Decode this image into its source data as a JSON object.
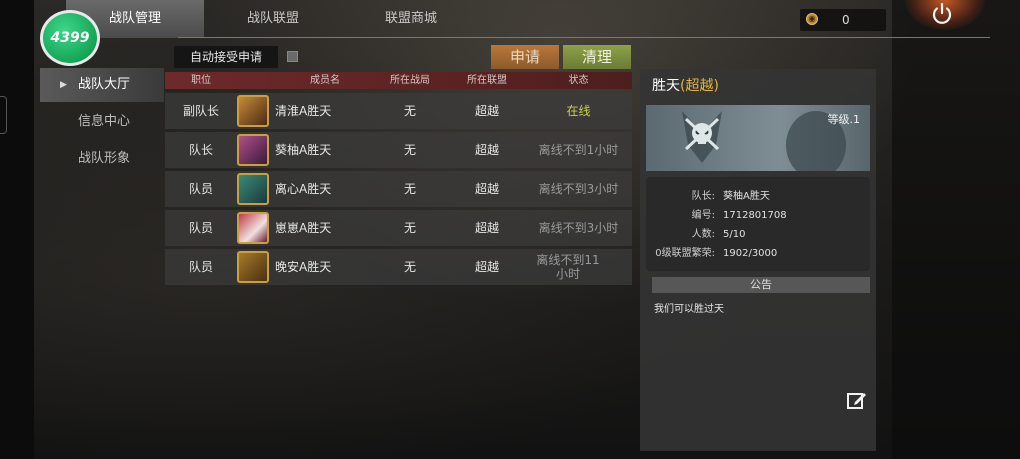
{
  "nav": {
    "tabs": [
      {
        "label": "战队管理",
        "active": true
      },
      {
        "label": "战队联盟",
        "active": false
      },
      {
        "label": "联盟商城",
        "active": false
      }
    ]
  },
  "logo": {
    "text": "4399"
  },
  "currency": {
    "icon": "coin-icon",
    "value": "0"
  },
  "power": {
    "icon": "power-icon"
  },
  "sidebar": {
    "items": [
      {
        "label": "战队大厅",
        "active": true
      },
      {
        "label": "信息中心",
        "active": false
      },
      {
        "label": "战队形象",
        "active": false
      }
    ]
  },
  "controls": {
    "auto_accept_label": "自动接受申请",
    "auto_accept_checked": false,
    "apply_label": "申请",
    "clear_label": "清理"
  },
  "table": {
    "headers": [
      "职位",
      "成员名",
      "所在战局",
      "所在联盟",
      "状态"
    ],
    "rows": [
      {
        "role": "副队长",
        "name": "清淮A胜天",
        "battle": "无",
        "alliance": "超越",
        "status": "在线",
        "avatar_color": "#c98a3a"
      },
      {
        "role": "队长",
        "name": "葵柚A胜天",
        "battle": "无",
        "alliance": "超越",
        "status": "离线不到1小时",
        "avatar_color": "#b0508a"
      },
      {
        "role": "队员",
        "name": "离心A胜天",
        "battle": "无",
        "alliance": "超越",
        "status": "离线不到3小时",
        "avatar_color": "#3a8a7a"
      },
      {
        "role": "队员",
        "name": "崽崽A胜天",
        "battle": "无",
        "alliance": "超越",
        "status": "离线不到3小时",
        "avatar_color": "#c03a4a"
      },
      {
        "role": "队员",
        "name": "晚安A胜天",
        "battle": "无",
        "alliance": "超越",
        "status": "离线不到11小时",
        "avatar_color": "#a87a2a"
      }
    ]
  },
  "team": {
    "name": "胜天",
    "alliance": "(超越)",
    "level": "等级.1",
    "details": [
      {
        "label": "队长:",
        "value": "葵柚A胜天"
      },
      {
        "label": "编号:",
        "value": "1712801708"
      },
      {
        "label": "人数:",
        "value": "5/10"
      },
      {
        "label": "0级联盟繁荣:",
        "value": "1902/3000"
      }
    ],
    "notice_title": "公告",
    "notice_text": "我们可以胜过天"
  },
  "colors": {
    "accent_online": "#c9d24a",
    "apply_button": "#b7783c",
    "clear_button": "#8da14a",
    "table_header": "#6e2a2a"
  }
}
